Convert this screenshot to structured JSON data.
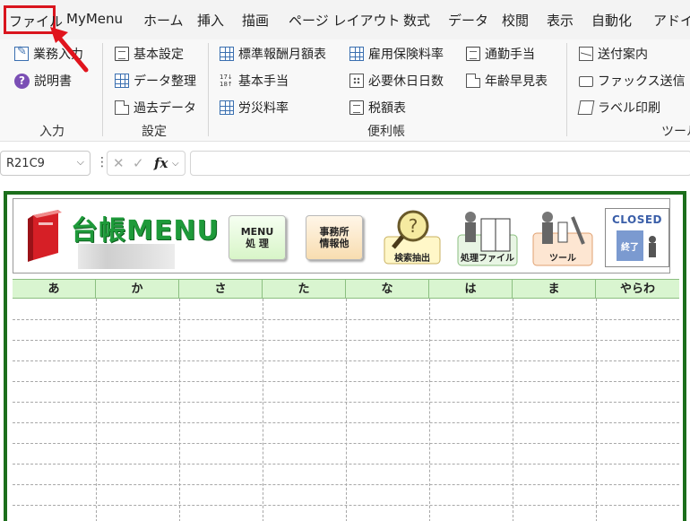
{
  "menubar": {
    "tabs": [
      "ファイル",
      "MyMenu",
      "ホーム",
      "挿入",
      "描画",
      "ページ レイアウト",
      "数式",
      "データ",
      "校閲",
      "表示",
      "自動化",
      "アドイン"
    ]
  },
  "ribbon": {
    "input": {
      "label": "入力",
      "items": [
        "業務入力",
        "説明書"
      ]
    },
    "settings": {
      "label": "設定",
      "items": [
        "基本設定",
        "データ整理",
        "過去データ"
      ]
    },
    "tools_col": {
      "label": "便利帳",
      "col1": [
        "標準報酬月額表",
        "基本手当",
        "労災料率"
      ],
      "col2": [
        "雇用保険料率",
        "必要休日日数",
        "税額表"
      ],
      "col3": [
        "通勤手当",
        "年齢早見表"
      ]
    },
    "tools": {
      "label": "ツール",
      "items": [
        "送付案内",
        "ファックス送信",
        "ラベル印刷"
      ]
    }
  },
  "formula_bar": {
    "name_box": "R21C9",
    "fx": "fx",
    "cancel_symbol": "✕",
    "enter_symbol": "✓",
    "value": ""
  },
  "sheet": {
    "title": "台帳MENU",
    "buttons": {
      "menu": "MENU\n処 理",
      "office": "事務所\n情報他",
      "search": "検索抽出",
      "process": "処理ファイル",
      "tool": "ツール",
      "closed": "CLOSED",
      "closed_sub": "終了"
    },
    "columns": [
      "あ",
      "か",
      "さ",
      "た",
      "な",
      "は",
      "ま",
      "やらわ"
    ],
    "row_count": 11
  },
  "colors": {
    "accent_red": "#d9141d",
    "sheet_border": "#1c6e1c",
    "header_fill": "#d9f5d0",
    "title_green": "#1e9a3a"
  }
}
